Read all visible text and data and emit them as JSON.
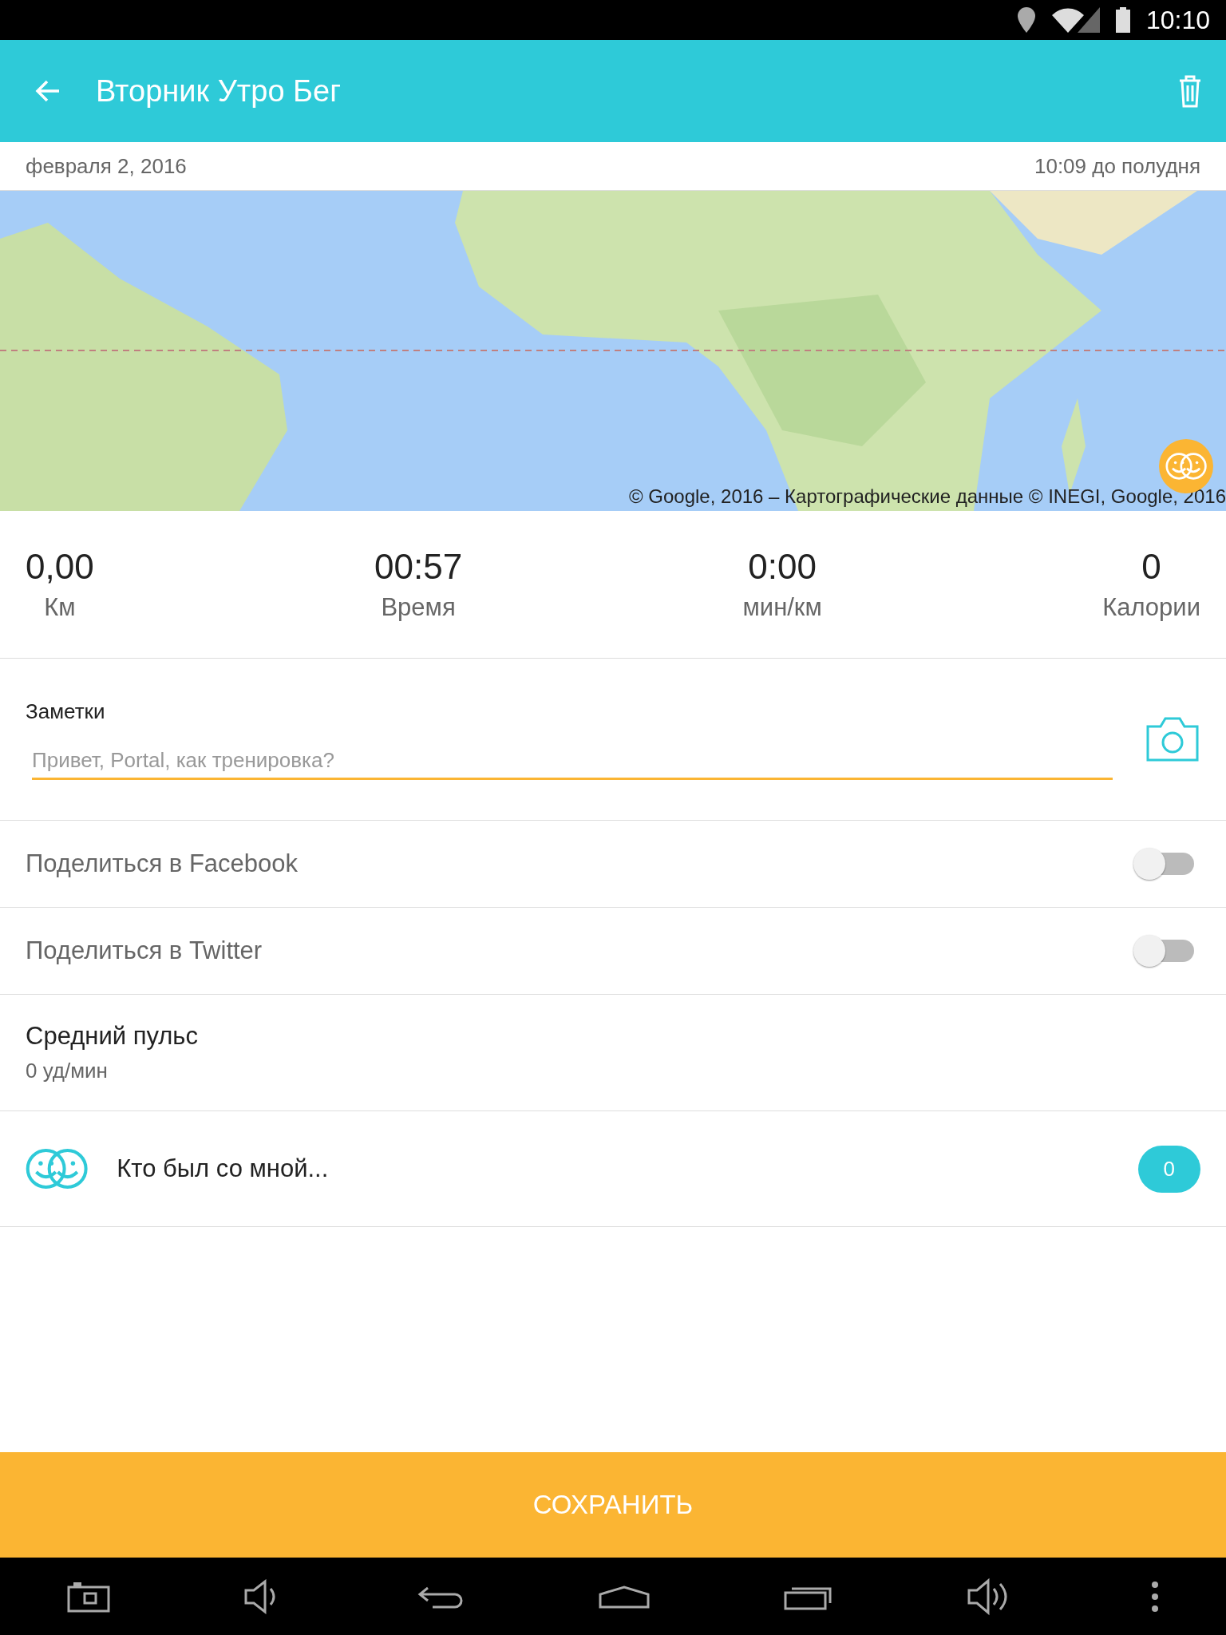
{
  "status_bar": {
    "time": "10:10"
  },
  "app_bar": {
    "title": "Вторник Утро Бег"
  },
  "date_row": {
    "date": "февраля 2, 2016",
    "time": "10:09 до полудня"
  },
  "map": {
    "attribution": "© Google, 2016 – Картографические данные © INEGI, Google, 2016"
  },
  "stats": [
    {
      "value": "0,00",
      "label": "Км"
    },
    {
      "value": "00:57",
      "label": "Время"
    },
    {
      "value": "0:00",
      "label": "мин/км"
    },
    {
      "value": "0",
      "label": "Калории"
    }
  ],
  "notes": {
    "label": "Заметки",
    "placeholder": "Привет, Portal, как тренировка?"
  },
  "shares": [
    {
      "label": "Поделиться в Facebook",
      "on": false
    },
    {
      "label": "Поделиться в Twitter",
      "on": false
    }
  ],
  "pulse": {
    "label": "Средний пульс",
    "value": "0 уд/мин"
  },
  "companions": {
    "label": "Кто был со мной...",
    "count": "0"
  },
  "save_button": "СОХРАНИТЬ"
}
